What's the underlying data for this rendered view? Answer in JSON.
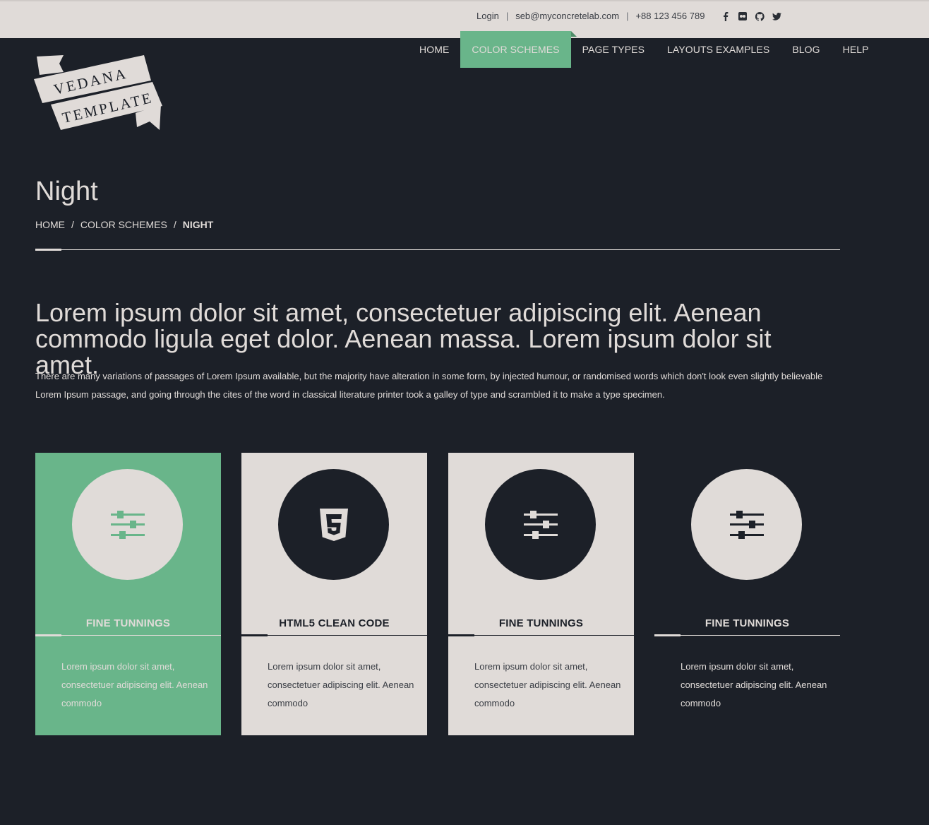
{
  "topbar": {
    "login": "Login",
    "separator": "|",
    "email": "seb@myconcretelab.com",
    "phone": "+88 123 456 789",
    "social": [
      "facebook-icon",
      "flickr-icon",
      "github-icon",
      "twitter-icon"
    ]
  },
  "logo": {
    "line1": "VEDANA",
    "line2": "TEMPLATE"
  },
  "nav": {
    "items": [
      {
        "label": "HOME"
      },
      {
        "label": "COLOR SCHEMES",
        "active": true
      },
      {
        "label": "PAGE TYPES"
      },
      {
        "label": "LAYOUTS EXAMPLES"
      },
      {
        "label": "BLOG"
      },
      {
        "label": "HELP"
      }
    ]
  },
  "page": {
    "title": "Night",
    "breadcrumb": {
      "home": "HOME",
      "sep": "/",
      "parent": "COLOR SCHEMES",
      "current": "NIGHT"
    }
  },
  "lead": "Lorem ipsum dolor sit amet, consectetuer adipiscing elit. Aenean commodo ligula eget dolor. Aenean massa. Lorem ipsum dolor sit amet.",
  "body_text": "There are many variations of passages of Lorem Ipsum available, but the majority have alteration in some form, by injected humour, or randomised words which don't look even slightly believable Lorem Ipsum passage, and going through the cites of the word in classical literature printer took a galley of type and scrambled it to make a type specimen.",
  "cards": [
    {
      "title": "FINE TUNNINGS",
      "text": "Lorem ipsum dolor sit amet, consectetuer adipiscing elit. Aenean commodo",
      "icon": "sliders-icon"
    },
    {
      "title": "HTML5 CLEAN CODE",
      "text": "Lorem ipsum dolor sit amet, consectetuer adipiscing elit. Aenean commodo",
      "icon": "html5-icon"
    },
    {
      "title": "FINE TUNNINGS",
      "text": "Lorem ipsum dolor sit amet, consectetuer adipiscing elit. Aenean commodo",
      "icon": "sliders-icon"
    },
    {
      "title": "FINE TUNNINGS",
      "text": "Lorem ipsum dolor sit amet, consectetuer adipiscing elit. Aenean commodo",
      "icon": "sliders-icon"
    }
  ],
  "colors": {
    "background": "#1c2028",
    "light": "#e0dbd8",
    "accent": "#69b58a"
  }
}
